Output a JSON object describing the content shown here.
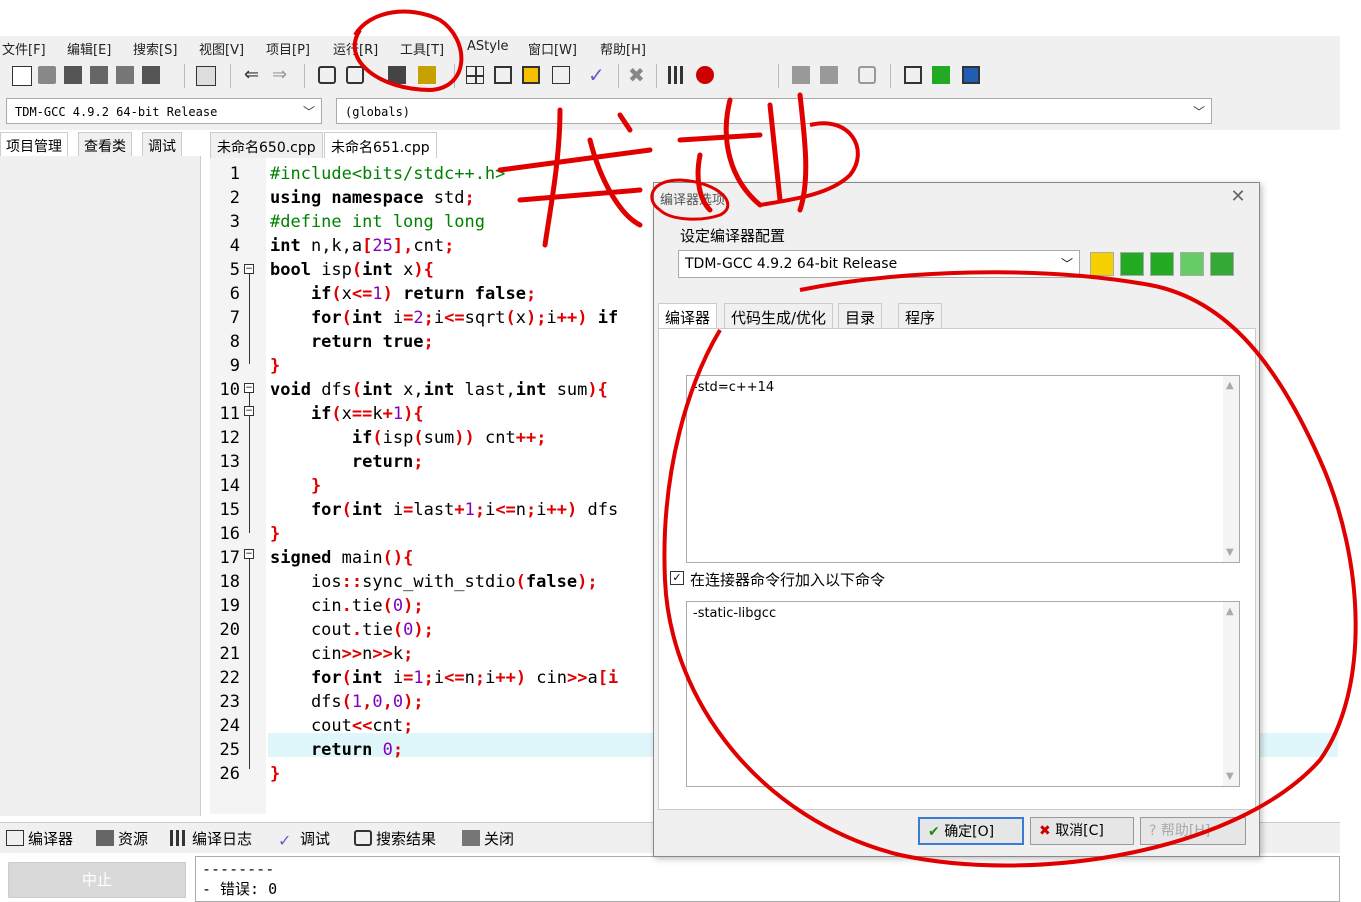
{
  "menu": [
    "文件[F]",
    "编辑[E]",
    "搜索[S]",
    "视图[V]",
    "项目[P]",
    "运行[R]",
    "工具[T]",
    "AStyle",
    "窗口[W]",
    "帮助[H]"
  ],
  "combos": {
    "compiler": "TDM-GCC 4.9.2 64-bit Release",
    "scope": "(globals)"
  },
  "left_tabs": [
    "项目管理",
    "查看类",
    "调试"
  ],
  "editor_tabs": [
    "未命名650.cpp",
    "未命名651.cpp"
  ],
  "code_lines": [
    "1",
    "2",
    "3",
    "4",
    "5",
    "6",
    "7",
    "8",
    "9",
    "10",
    "11",
    "12",
    "13",
    "14",
    "15",
    "16",
    "17",
    "18",
    "19",
    "20",
    "21",
    "22",
    "23",
    "24",
    "25",
    "26"
  ],
  "code": {
    "l1a": "#include<bits/stdc++.h>",
    "l2a": "using",
    "l2b": " namespace",
    "l2c": " std",
    "l2d": ";",
    "l3a": "#define int long long",
    "l4a": "int",
    "l4b": " n,k,a",
    "l4c": "[",
    "l4d": "25",
    "l4e": "],",
    "l4f": "cnt",
    "l4g": ";",
    "l5a": "bool",
    "l5b": " isp",
    "l5c": "(",
    "l5d": "int",
    "l5e": " x",
    "l5f": "){",
    "l6a": "    if",
    "l6b": "(",
    "l6c": "x",
    "l6d": "<=",
    "l6e": "1",
    "l6f": ")",
    "l6g": " return false",
    "l6h": ";",
    "l7a": "    for",
    "l7b": "(",
    "l7c": "int",
    "l7d": " i",
    "l7e": "=",
    "l7f": "2",
    "l7g": ";",
    "l7h": "i",
    "l7i": "<=",
    "l7j": "sqrt",
    "l7k": "(",
    "l7l": "x",
    "l7m": ");",
    "l7n": "i",
    "l7o": "++)",
    "l7p": " if",
    "l8a": "    return true",
    "l8b": ";",
    "l9a": "}",
    "l10a": "void",
    "l10b": " dfs",
    "l10c": "(",
    "l10d": "int",
    "l10e": " x,",
    "l10f": "int",
    "l10g": " last,",
    "l10h": "int",
    "l10i": " sum",
    "l10j": "){",
    "l11a": "    if",
    "l11b": "(",
    "l11c": "x",
    "l11d": "==",
    "l11e": "k",
    "l11f": "+",
    "l11g": "1",
    "l11h": "){",
    "l12a": "        if",
    "l12b": "(",
    "l12c": "isp",
    "l12d": "(",
    "l12e": "sum",
    "l12f": "))",
    "l12g": " cnt",
    "l12h": "++;",
    "l13a": "        return",
    "l13b": ";",
    "l14a": "    }",
    "l15a": "    for",
    "l15b": "(",
    "l15c": "int",
    "l15d": " i",
    "l15e": "=",
    "l15f": "last",
    "l15g": "+",
    "l15h": "1",
    "l15i": ";",
    "l15j": "i",
    "l15k": "<=",
    "l15l": "n",
    "l15m": ";",
    "l15n": "i",
    "l15o": "++)",
    "l15p": " dfs",
    "l16a": "}",
    "l17a": "signed",
    "l17b": " main",
    "l17c": "(){",
    "l18a": "    ios",
    "l18b": "::",
    "l18c": "sync_with_stdio",
    "l18d": "(",
    "l18e": "false",
    "l18f": ");",
    "l19a": "    cin",
    "l19b": ".",
    "l19c": "tie",
    "l19d": "(",
    "l19e": "0",
    "l19f": ");",
    "l20a": "    cout",
    "l20b": ".",
    "l20c": "tie",
    "l20d": "(",
    "l20e": "0",
    "l20f": ");",
    "l21a": "    cin",
    "l21b": ">>",
    "l21c": "n",
    "l21d": ">>",
    "l21e": "k",
    "l21f": ";",
    "l22a": "    for",
    "l22b": "(",
    "l22c": "int",
    "l22d": " i",
    "l22e": "=",
    "l22f": "1",
    "l22g": ";",
    "l22h": "i",
    "l22i": "<=",
    "l22j": "n",
    "l22k": ";",
    "l22l": "i",
    "l22m": "++)",
    "l22n": " cin",
    "l22o": ">>",
    "l22p": "a",
    "l22q": "[i",
    "l23a": "    dfs",
    "l23b": "(",
    "l23c": "1",
    "l23d": ",",
    "l23e": "0",
    "l23f": ",",
    "l23g": "0",
    "l23h": ");",
    "l24a": "    cout",
    "l24b": "<<",
    "l24c": "cnt",
    "l24d": ";",
    "l25a": "    return",
    "l25b": " 0",
    "l25c": ";",
    "l26a": "}"
  },
  "dialog": {
    "title": "编译器选项",
    "group_label": "设定编译器配置",
    "config_value": "TDM-GCC 4.9.2 64-bit Release",
    "tabs": [
      "编译器",
      "代码生成/优化",
      "目录",
      "程序"
    ],
    "compiler_args": "-std=c++14",
    "linker_checkbox_label": "在连接器命令行加入以下命令",
    "linker_checked": true,
    "linker_args": "-static-libgcc",
    "ok_label": "确定[O]",
    "cancel_label": "取消[C]",
    "help_label": "帮助[H]"
  },
  "bottom_tabs": [
    "编译器",
    "资源",
    "编译日志",
    "调试",
    "搜索结果",
    "关闭"
  ],
  "stop_label": "中止",
  "log_lines": [
    "--------",
    "- 错误: 0"
  ],
  "annotation_text": "找到"
}
